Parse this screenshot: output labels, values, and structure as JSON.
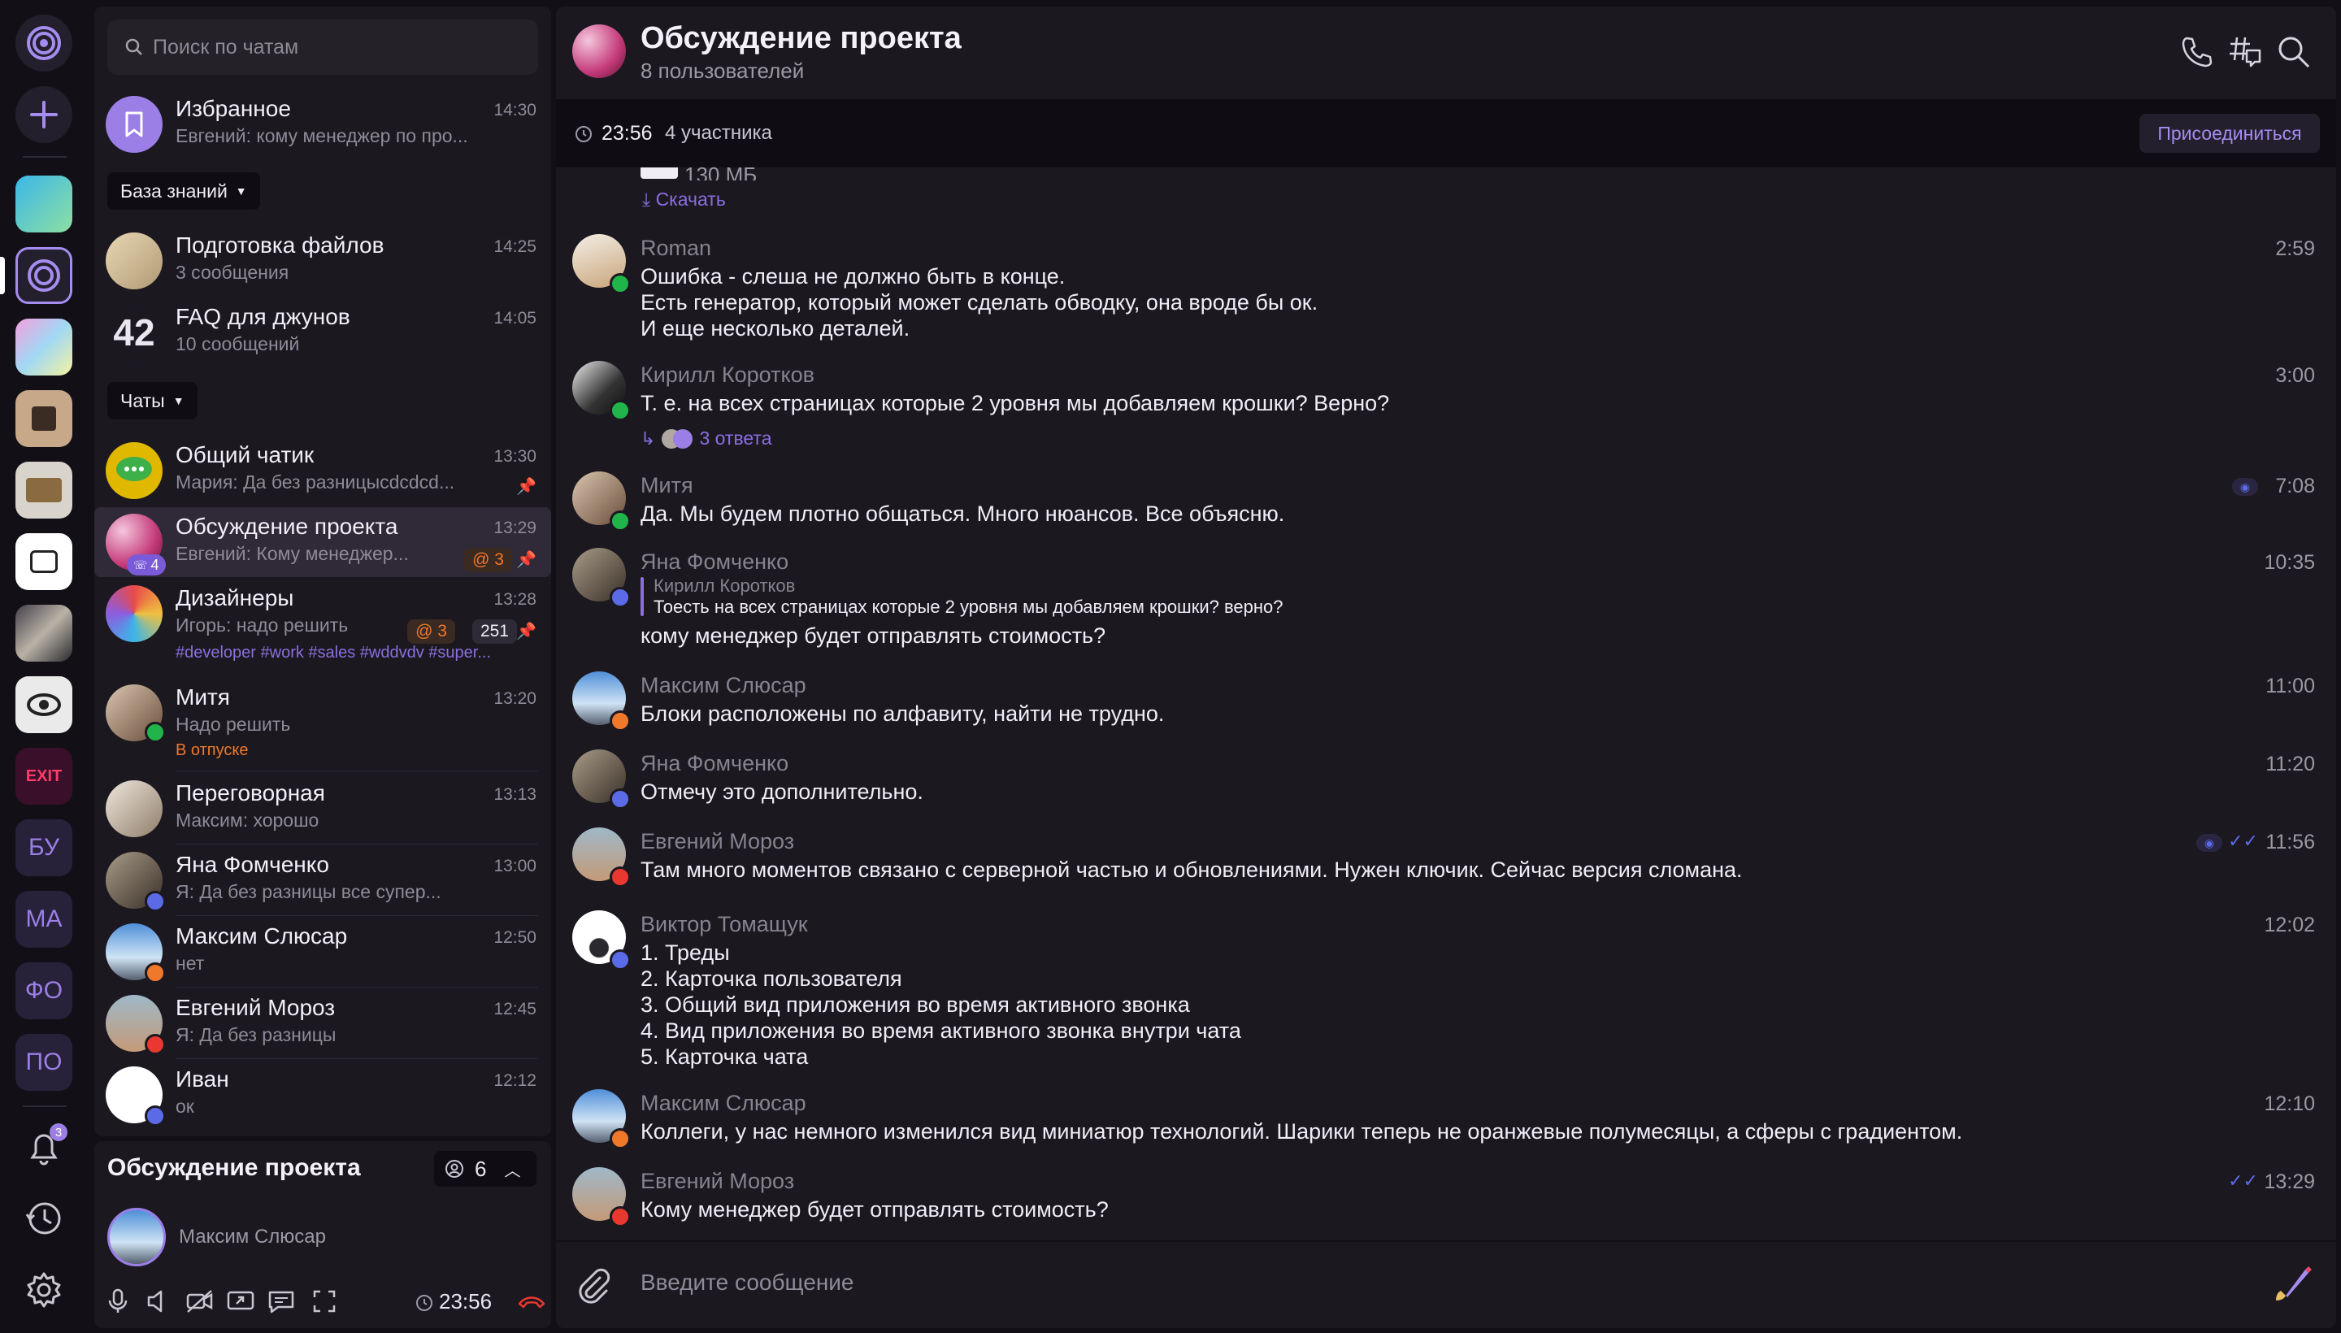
{
  "rail": {
    "items": [
      {
        "name": "app-logo-icon"
      },
      {
        "name": "add-icon"
      },
      {
        "name": "workspace-1"
      },
      {
        "name": "workspace-2"
      },
      {
        "name": "workspace-3"
      },
      {
        "name": "workspace-4"
      },
      {
        "name": "workspace-5"
      },
      {
        "name": "workspace-6"
      },
      {
        "name": "workspace-7"
      },
      {
        "name": "workspace-8"
      },
      {
        "name": "workspace-9"
      }
    ],
    "text_items": [
      "БУ",
      "МА",
      "ФО",
      "ПО"
    ],
    "notifications_badge": "3"
  },
  "search": {
    "placeholder": "Поиск по чатам"
  },
  "favorites": {
    "name": "Избранное",
    "preview": "Евгений: кому менеджер по про...",
    "time": "14:30"
  },
  "sections": {
    "knowledge": "База знаний",
    "chats": "Чаты"
  },
  "knowledge_items": [
    {
      "name": "Подготовка файлов",
      "preview": "3 сообщения",
      "time": "14:25"
    },
    {
      "name": "FAQ для джунов",
      "preview": "10 сообщений",
      "time": "14:05"
    }
  ],
  "chats": [
    {
      "name": "Общий чатик",
      "preview": "Мария: Да без разницысdcdcd...",
      "time": "13:30"
    },
    {
      "name": "Обсуждение проекта",
      "preview": "Евгений: Кому менеджер...",
      "time": "13:29",
      "mention": "@ 3",
      "call_count": "4"
    },
    {
      "name": "Дизайнеры",
      "preview": "Игорь: надо решить",
      "time": "13:28",
      "mention": "@ 3",
      "unread": "251",
      "tags": "#developer #work #sales #wddvdv #super..."
    },
    {
      "name": "Митя",
      "preview": "Надо решить",
      "time": "13:20",
      "status": "В отпуске"
    },
    {
      "name": "Переговорная",
      "preview": "Максим: хорошо",
      "time": "13:13"
    },
    {
      "name": "Яна Фомченко",
      "preview": "Я: Да без разницы все супер...",
      "time": "13:00"
    },
    {
      "name": "Максим Слюсар",
      "preview": "нет",
      "time": "12:50"
    },
    {
      "name": "Евгений Мороз",
      "preview": "Я: Да без разницы",
      "time": "12:45"
    },
    {
      "name": "Иван",
      "preview": "ок",
      "time": "12:12"
    }
  ],
  "call_panel": {
    "title": "Обсуждение проекта",
    "participants": "6",
    "speaker": "Максим Слюсар",
    "timer": "23:56"
  },
  "header": {
    "title": "Обсуждение проекта",
    "subtitle": "8 пользователей"
  },
  "callbar": {
    "timer": "23:56",
    "participants": "4 участника",
    "join": "Присоединиться"
  },
  "file_fragment": {
    "size": "130 МБ",
    "download": "Скачать"
  },
  "messages": [
    {
      "author": "Roman",
      "text": "Ошибка - слеша не должно быть в конце.\nЕсть генератор, который может сделать обводку, она вроде бы ок.\nИ еще несколько деталей.",
      "time": "2:59"
    },
    {
      "author": "Кирилл Коротков",
      "text": "Т. е. на всех страницах которые 2 уровня мы добавляем крошки? Верно?",
      "time": "3:00",
      "replies": "3 ответа"
    },
    {
      "author": "Митя",
      "text": "Да. Мы будем плотно общаться. Много нюансов. Все объясню.",
      "time": "7:08"
    },
    {
      "author": "Яна Фомченко",
      "quote_author": "Кирилл Коротков",
      "quote": "Тоесть на всех страницах которые 2 уровня мы добавляем крошки? верно?",
      "text": "кому менеджер будет отправлять стоимость?",
      "time": "10:35"
    },
    {
      "author": "Максим Слюсар",
      "text": "Блоки расположены по алфавиту, найти не трудно.",
      "time": "11:00"
    },
    {
      "author": "Яна Фомченко",
      "text": "Отмечу это дополнительно.",
      "time": "11:20"
    },
    {
      "author": "Евгений Мороз",
      "text": "Там много моментов связано с серверной частью и обновлениями. Нужен ключик. Сейчас версия сломана.",
      "time": "11:56"
    },
    {
      "author": "Виктор Томащук",
      "text": "1. Треды\n2. Карточка пользователя\n3. Общий вид приложения во время активного звонка\n4. Вид приложения во время активного звонка внутри чата\n5. Карточка чата",
      "time": "12:02"
    },
    {
      "author": "Максим Слюсар",
      "text": "Коллеги, у нас немного изменился вид миниатюр технологий. Шарики теперь не оранжевые полумесяцы, а сферы с градиентом.",
      "time": "12:10"
    },
    {
      "author": "Евгений Мороз",
      "text": "Кому менеджер будет отправлять стоимость?",
      "time": "13:29"
    }
  ],
  "composer": {
    "placeholder": "Введите сообщение"
  },
  "colors": {
    "accent": "#9b7ee6",
    "background": "#121016",
    "panel": "#1b1820",
    "mention": "#f0782a",
    "online": "#20b44a"
  }
}
